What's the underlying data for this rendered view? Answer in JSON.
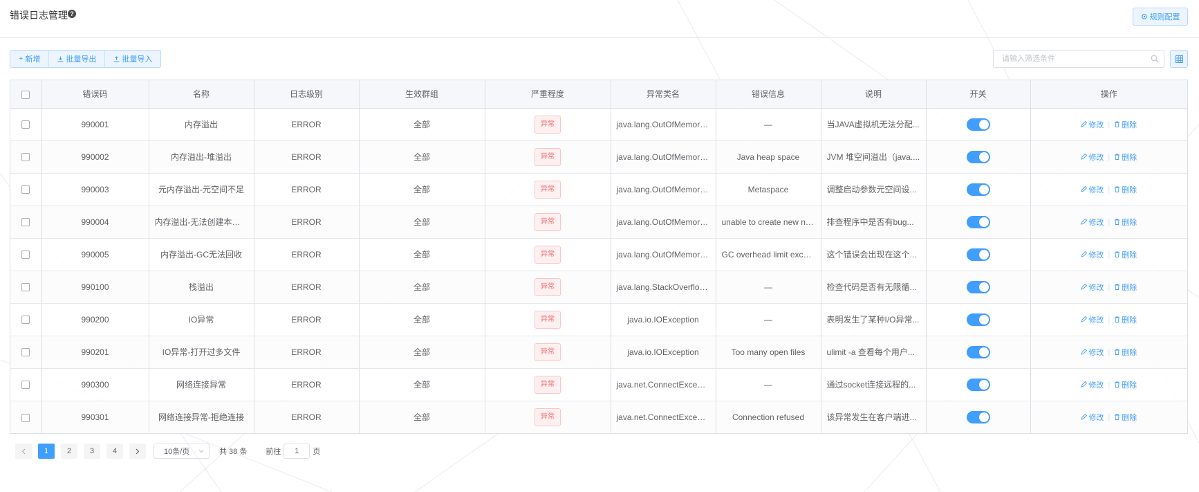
{
  "header": {
    "title": "错误日志管理",
    "rule_button": "规则配置"
  },
  "toolbar": {
    "add_label": "新增",
    "export_label": "批量导出",
    "import_label": "批量导入"
  },
  "search": {
    "placeholder": "请输入筛选条件"
  },
  "table": {
    "columns": [
      "错误码",
      "名称",
      "日志级别",
      "生效群组",
      "严重程度",
      "异常类名",
      "错误信息",
      "说明",
      "开关",
      "操作"
    ],
    "edit_label": "修改",
    "delete_label": "删除",
    "switch_on": true,
    "rows": [
      {
        "code": "990001",
        "name": "内存溢出",
        "level": "ERROR",
        "group": "全部",
        "severity": "异常",
        "class": "java.lang.OutOfMemoryError",
        "message": "—",
        "desc": "当JAVA虚拟机无法分配..."
      },
      {
        "code": "990002",
        "name": "内存溢出-堆溢出",
        "level": "ERROR",
        "group": "全部",
        "severity": "异常",
        "class": "java.lang.OutOfMemoryError",
        "message": "Java heap space",
        "desc": "JVM 堆空间溢出（java...."
      },
      {
        "code": "990003",
        "name": "元内存溢出-元空间不足",
        "level": "ERROR",
        "group": "全部",
        "severity": "异常",
        "class": "java.lang.OutOfMemoryError",
        "message": "Metaspace",
        "desc": "调整启动参数元空间设..."
      },
      {
        "code": "990004",
        "name": "内存溢出-无法创建本地线程",
        "level": "ERROR",
        "group": "全部",
        "severity": "异常",
        "class": "java.lang.OutOfMemoryError",
        "message": "unable to create new native thread",
        "desc": "排查程序中是否有bug..."
      },
      {
        "code": "990005",
        "name": "内存溢出-GC无法回收",
        "level": "ERROR",
        "group": "全部",
        "severity": "异常",
        "class": "java.lang.OutOfMemoryError",
        "message": "GC overhead limit exceeded",
        "desc": "这个错误会出现在这个..."
      },
      {
        "code": "990100",
        "name": "栈溢出",
        "level": "ERROR",
        "group": "全部",
        "severity": "异常",
        "class": "java.lang.StackOverflowError",
        "message": "—",
        "desc": "检查代码是否有无限循..."
      },
      {
        "code": "990200",
        "name": "IO异常",
        "level": "ERROR",
        "group": "全部",
        "severity": "异常",
        "class": "java.io.IOException",
        "message": "—",
        "desc": "表明发生了某种I/O异常..."
      },
      {
        "code": "990201",
        "name": "IO异常-打开过多文件",
        "level": "ERROR",
        "group": "全部",
        "severity": "异常",
        "class": "java.io.IOException",
        "message": "Too many open files",
        "desc": "ulimit -a 查看每个用户..."
      },
      {
        "code": "990300",
        "name": "网络连接异常",
        "level": "ERROR",
        "group": "全部",
        "severity": "异常",
        "class": "java.net.ConnectException",
        "message": "—",
        "desc": "通过socket连接远程的..."
      },
      {
        "code": "990301",
        "name": "网络连接异常-拒绝连接",
        "level": "ERROR",
        "group": "全部",
        "severity": "异常",
        "class": "java.net.ConnectException",
        "message": "Connection refused",
        "desc": "该异常发生在客户端进..."
      }
    ]
  },
  "pagination": {
    "pages": [
      "1",
      "2",
      "3",
      "4"
    ],
    "current": "1",
    "page_size": "10条/页",
    "total": "共 38 条",
    "goto_prefix": "前往",
    "goto_value": "1",
    "goto_suffix": "页"
  },
  "colors": {
    "primary": "#409eff",
    "danger": "#f56c6c",
    "header_bg": "#f5f7fa"
  }
}
